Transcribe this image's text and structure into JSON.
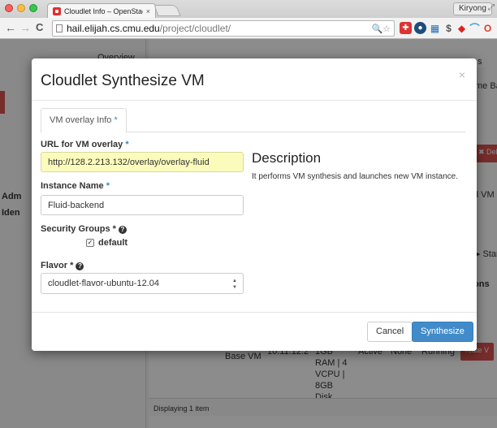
{
  "browser": {
    "tab_title": "Cloudlet Info – OpenStack",
    "tab_close": "×",
    "profile_name": "Kiryong",
    "url_host": "hail.elijah.cs.cmu.edu",
    "url_path": "/project/cloudlet/",
    "omnibox_icons": "🔍☆",
    "extension_icons": [
      "shield-icon",
      "record-icon",
      "clipboard-icon",
      "dollar-icon",
      "reddit-icon",
      "wifi-icon",
      "opera-icon"
    ],
    "menu_glyph": "≡"
  },
  "background": {
    "sidebar_items": [
      {
        "label": "Overview"
      },
      {
        "label": "Adm"
      },
      {
        "label": "Iden"
      }
    ],
    "table_header_fragments": [
      "me Bas",
      "s"
    ],
    "side_buttons": [
      "✖ Del",
      "d VM o",
      "▶ Start",
      "ons",
      "reate V"
    ],
    "row": {
      "name": "Base VM",
      "ip": "10.11.12.2",
      "flavor": "1GB RAM | 4 VCPU | 8GB Disk",
      "status": "Active",
      "task": "None",
      "power": "Running"
    },
    "footer": "Displaying 1 item"
  },
  "modal": {
    "title": "Cloudlet Synthesize VM",
    "close": "×",
    "tab_label": "VM overlay Info",
    "required_mark": "*",
    "url_label": "URL for VM overlay",
    "url_value": "http://128.2.213.132/overlay/overlay-fluid",
    "instance_label": "Instance Name",
    "instance_value": "Fluid-backend",
    "security_label": "Security Groups",
    "security_option": "default",
    "security_checked": true,
    "flavor_label": "Flavor",
    "flavor_value": "cloudlet-flavor-ubuntu-12.04",
    "help_glyph": "?",
    "description_title": "Description",
    "description_text": "It performs VM synthesis and launches new VM instance.",
    "cancel_label": "Cancel",
    "submit_label": "Synthesize"
  },
  "colors": {
    "primary": "#428bca",
    "danger": "#d9534f",
    "highlight_input": "#fbfbbc"
  }
}
